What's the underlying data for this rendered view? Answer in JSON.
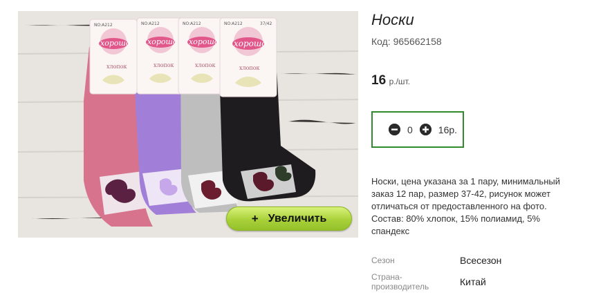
{
  "product": {
    "title": "Носки",
    "code_label": "Код:",
    "code": "965662158",
    "price_value": "16",
    "price_unit": "р./шт.",
    "zoom_label": "Увеличить",
    "zoom_icon": "+",
    "description": "Носки, цена указана за 1 пару, минимальный заказ 12 пар, размер 37-42, рисунок может отличаться от предоставленного на фото. Состав: 80% хлопок, 15% полиамид, 5% спандекс"
  },
  "quantity": {
    "minus_icon": "minus-circle-icon",
    "plus_icon": "plus-circle-icon",
    "value": "0",
    "total": "16р."
  },
  "attributes": [
    {
      "key": "Сезон",
      "value": "Всесезон"
    },
    {
      "key": "Страна-производитель",
      "value": "Китай"
    }
  ],
  "photo": {
    "tag_code": "NO:A212",
    "tag_size": "37/42",
    "brand": "хорошо",
    "material": "хлопок",
    "colors": {
      "pink": "#d9728d",
      "lavender": "#a07fd8",
      "grey": "#bdbdbd",
      "black": "#1e1c1f",
      "background": "#e9e5e0"
    }
  }
}
